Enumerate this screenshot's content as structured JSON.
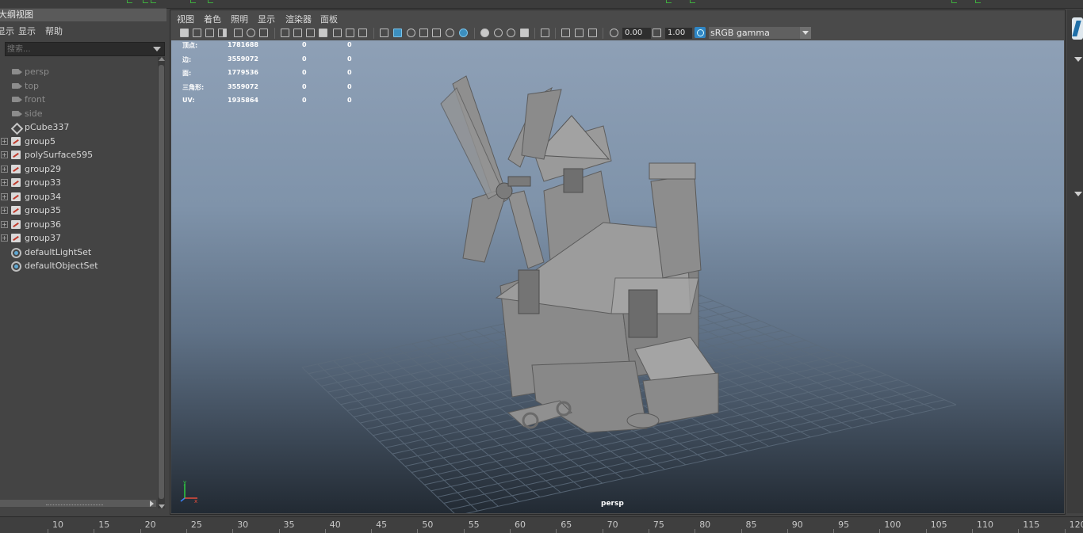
{
  "outliner": {
    "title": "大纲视图",
    "menu": [
      "显示",
      "显示",
      "帮助"
    ],
    "search_placeholder": "搜索...",
    "items": [
      {
        "label": "persp",
        "icon": "camera-icon",
        "dim": true
      },
      {
        "label": "top",
        "icon": "camera-icon",
        "dim": true
      },
      {
        "label": "front",
        "icon": "camera-icon",
        "dim": true
      },
      {
        "label": "side",
        "icon": "camera-icon",
        "dim": true
      },
      {
        "label": "pCube337",
        "icon": "mesh-icon",
        "dim": false
      },
      {
        "label": "group5",
        "icon": "group-icon",
        "dim": false,
        "expand": true
      },
      {
        "label": "polySurface595",
        "icon": "group-icon",
        "dim": false,
        "expand": true
      },
      {
        "label": "group29",
        "icon": "group-icon",
        "dim": false,
        "expand": true
      },
      {
        "label": "group33",
        "icon": "group-icon",
        "dim": false,
        "expand": true
      },
      {
        "label": "group34",
        "icon": "group-icon",
        "dim": false,
        "expand": true
      },
      {
        "label": "group35",
        "icon": "group-icon",
        "dim": false,
        "expand": true
      },
      {
        "label": "group36",
        "icon": "group-icon",
        "dim": false,
        "expand": true
      },
      {
        "label": "group37",
        "icon": "group-icon",
        "dim": false,
        "expand": true
      },
      {
        "label": "defaultLightSet",
        "icon": "set-icon",
        "dim": false
      },
      {
        "label": "defaultObjectSet",
        "icon": "set-icon",
        "dim": false
      }
    ]
  },
  "viewport": {
    "menu": [
      "视图",
      "着色",
      "照明",
      "显示",
      "渲染器",
      "面板"
    ],
    "toolbar": {
      "exposure": "0.00",
      "gamma": "1.00",
      "color_space": "sRGB gamma"
    },
    "hud": [
      {
        "label": "顶点:",
        "total": "1781688",
        "sel": "0",
        "comp": "0"
      },
      {
        "label": "边:",
        "total": "3559072",
        "sel": "0",
        "comp": "0"
      },
      {
        "label": "面:",
        "total": "1779536",
        "sel": "0",
        "comp": "0"
      },
      {
        "label": "三角形:",
        "total": "3559072",
        "sel": "0",
        "comp": "0"
      },
      {
        "label": "UV:",
        "total": "1935864",
        "sel": "0",
        "comp": "0"
      }
    ],
    "camera_label": "persp",
    "axis": {
      "y": "y",
      "x": "x"
    }
  },
  "timeslider": {
    "ticks": [
      "10",
      "15",
      "20",
      "25",
      "30",
      "35",
      "40",
      "45",
      "50",
      "55",
      "60",
      "65",
      "70",
      "75",
      "80",
      "85",
      "90",
      "95",
      "100",
      "105",
      "110",
      "115",
      "120"
    ]
  }
}
